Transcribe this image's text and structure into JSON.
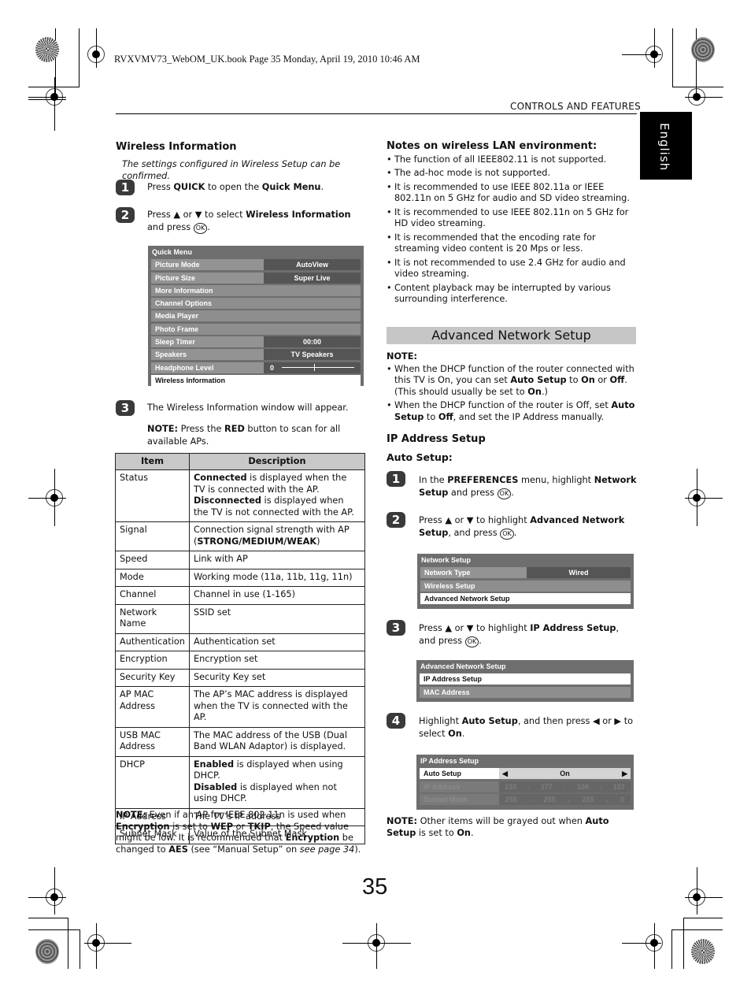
{
  "print_header": "RVXVMV73_WebOM_UK.book  Page 35  Monday, April 19, 2010  10:46 AM",
  "section_tag": "CONTROLS AND FEATURES",
  "language_tab": "English",
  "page_number": "35",
  "wireless_info": {
    "heading": "Wireless Information",
    "intro": "The settings configured in Wireless Setup can be confirmed.",
    "steps": [
      {
        "num": "1",
        "parts": [
          "Press ",
          "QUICK",
          " to open the ",
          "Quick Menu",
          "."
        ]
      },
      {
        "num": "2",
        "parts": [
          "Press ▲ or ▼ to select ",
          "Wireless Information",
          " and press ",
          "OK",
          "."
        ]
      },
      {
        "num": "3",
        "text": "The Wireless Information window will appear.",
        "note_label": "NOTE:",
        "note_pre": " Press the ",
        "note_bold": "RED",
        "note_post": " button to scan for all available APs."
      }
    ],
    "quick_menu": {
      "title": "Quick Menu",
      "rows": [
        {
          "label": "Picture Mode",
          "value": "AutoView"
        },
        {
          "label": "Picture Size",
          "value": "Super Live"
        },
        {
          "label": "More Information",
          "value": ""
        },
        {
          "label": "Channel Options",
          "value": ""
        },
        {
          "label": "Media Player",
          "value": ""
        },
        {
          "label": "Photo Frame",
          "value": ""
        },
        {
          "label": "Sleep Timer",
          "value": "00:00"
        },
        {
          "label": "Speakers",
          "value": "TV Speakers"
        },
        {
          "label": "Headphone Level",
          "value": "0",
          "slider_level": 0.45
        },
        {
          "label": "Wireless Information",
          "value": "",
          "selected": true
        }
      ]
    },
    "table": {
      "headers": [
        "Item",
        "Description"
      ],
      "rows": [
        [
          "Status",
          "Connected is displayed when the TV is connected with the AP. Disconnected is displayed when the TV is not connected with the AP."
        ],
        [
          "Signal",
          "Connection signal strength with AP (STRONG/MEDIUM/WEAK)"
        ],
        [
          "Speed",
          "Link with AP"
        ],
        [
          "Mode",
          "Working mode (11a, 11b, 11g, 11n)"
        ],
        [
          "Channel",
          "Channel in use (1-165)"
        ],
        [
          "Network Name",
          "SSID set"
        ],
        [
          "Authentication",
          "Authentication set"
        ],
        [
          "Encryption",
          "Encryption set"
        ],
        [
          "Security Key",
          "Security Key set"
        ],
        [
          "AP MAC Address",
          "The AP’s MAC address is displayed when the TV is connected with the AP."
        ],
        [
          "USB MAC Address",
          "The MAC address of the USB (Dual Band WLAN Adaptor) is displayed."
        ],
        [
          "DHCP",
          "Enabled is displayed when using DHCP. Disabled is displayed when not using DHCP."
        ],
        [
          "IP Address",
          "The TV’s IP address"
        ],
        [
          "Subnet Mask",
          "Value of the Subnet Mask"
        ]
      ]
    },
    "bottom_note": {
      "label": "NOTE:",
      "text_parts": [
        " Even if an AP for IEEE 802.11n is used when ",
        "Encryption",
        " is set to ",
        "WEP",
        " or ",
        "TKIP",
        ", the Speed value might be low. It is recommended that ",
        "Encryption",
        " be changed to ",
        "AES",
        " (see “Manual Setup” on ",
        "see page 34",
        ")."
      ]
    }
  },
  "lan_notes": {
    "heading": "Notes on wireless LAN environment:",
    "items": [
      "The function of all IEEE802.11 is not supported.",
      "The ad-hoc mode is not supported.",
      "It is recommended to use IEEE 802.11a or IEEE 802.11n on 5 GHz for audio and SD video streaming.",
      "It is recommended to use IEEE 802.11n on 5 GHz for HD video streaming.",
      "It is recommended that the encoding rate for streaming video content is 20 Mps or less.",
      "It is not recommended to use 2.4 GHz for audio and video streaming.",
      "Content playback may be interrupted by various surrounding interference."
    ]
  },
  "advanced": {
    "banner": "Advanced Network Setup",
    "note_label": "NOTE:",
    "note_items": [
      [
        "When the DHCP function of the router connected with this TV is On, you can set ",
        "Auto Setup",
        " to ",
        "On",
        " or ",
        "Off",
        ". (This should usually be set to ",
        "On",
        ".)"
      ],
      [
        "When the DHCP function of the router is Off, set ",
        "Auto Setup",
        " to ",
        "Off",
        ", and set the IP Address manually."
      ]
    ],
    "ip_heading": "IP Address Setup",
    "auto_heading": "Auto Setup:",
    "steps": [
      {
        "num": "1",
        "parts": [
          "In the ",
          "PREFERENCES",
          " menu, highlight ",
          "Network Setup",
          " and press ",
          "OK",
          "."
        ]
      },
      {
        "num": "2",
        "parts": [
          "Press ▲ or ▼ to highlight ",
          "Advanced Network Setup",
          ", and press ",
          "OK",
          "."
        ]
      },
      {
        "num": "3",
        "parts": [
          "Press ▲ or ▼ to highlight ",
          "IP Address Setup",
          ", and press ",
          "OK",
          "."
        ]
      },
      {
        "num": "4",
        "parts": [
          "Highlight ",
          "Auto Setup",
          ", and then press ◀ or ▶ to select ",
          "On",
          "."
        ]
      }
    ],
    "network_menu": {
      "title": "Network Setup",
      "rows": [
        {
          "label": "Network Type",
          "value": "Wired"
        },
        {
          "label": "Wireless Setup",
          "value": ""
        },
        {
          "label": "Advanced Network Setup",
          "value": "",
          "selected": true
        }
      ]
    },
    "adv_menu": {
      "title": "Advanced Network Setup",
      "rows": [
        {
          "label": "IP Address Setup",
          "selected": true
        },
        {
          "label": "MAC Address"
        }
      ]
    },
    "ip_menu": {
      "title": "IP Address Setup",
      "auto_label": "Auto Setup",
      "auto_value": "On",
      "ip_label": "IP Address",
      "ip_octets": [
        "133",
        ".",
        "177",
        ".",
        "108",
        ".",
        "157"
      ],
      "mask_label": "Subnet Mask",
      "mask_octets": [
        "255",
        ".",
        "255",
        ".",
        "255",
        ".",
        "0"
      ]
    },
    "final_note": {
      "label": "NOTE:",
      "parts": [
        " Other items will be grayed out when ",
        "Auto Setup",
        " is set to ",
        "On",
        "."
      ]
    }
  }
}
